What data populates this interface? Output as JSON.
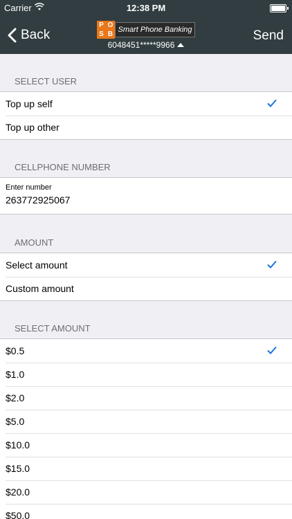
{
  "status": {
    "carrier": "Carrier",
    "time": "12:38 PM"
  },
  "nav": {
    "back_label": "Back",
    "send_label": "Send",
    "logo_letters": [
      "P",
      "O",
      "S",
      "B"
    ],
    "brand": "Smart Phone Banking",
    "account": "6048451*****9966"
  },
  "select_user": {
    "header": "SELECT USER",
    "items": [
      {
        "label": "Top up self",
        "checked": true
      },
      {
        "label": "Top up other",
        "checked": false
      }
    ]
  },
  "cellphone": {
    "header": "CELLPHONE NUMBER",
    "field_label": "Enter number",
    "value": "263772925067"
  },
  "amount": {
    "header": "AMOUNT",
    "items": [
      {
        "label": "Select amount",
        "checked": true
      },
      {
        "label": "Custom amount",
        "checked": false
      }
    ]
  },
  "select_amount": {
    "header": "SELECT AMOUNT",
    "items": [
      {
        "label": "$0.5",
        "checked": true
      },
      {
        "label": "$1.0",
        "checked": false
      },
      {
        "label": "$2.0",
        "checked": false
      },
      {
        "label": "$5.0",
        "checked": false
      },
      {
        "label": "$10.0",
        "checked": false
      },
      {
        "label": "$15.0",
        "checked": false
      },
      {
        "label": "$20.0",
        "checked": false
      },
      {
        "label": "$50.0",
        "checked": false
      }
    ]
  },
  "colors": {
    "navbar": "#313d40",
    "accent": "#1a73d9",
    "logo": "#e8771a"
  }
}
